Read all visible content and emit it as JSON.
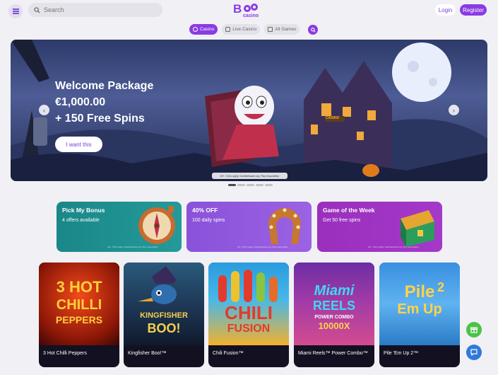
{
  "header": {
    "search_placeholder": "Search",
    "logo_text": "casino",
    "login_label": "Login",
    "register_label": "Register"
  },
  "tabs": [
    {
      "label": "Casino",
      "active": true
    },
    {
      "label": "Live Casino",
      "active": false
    },
    {
      "label": "All Games",
      "active": false
    }
  ],
  "hero": {
    "line1": "Welcome Package",
    "line2": "€1,000.00",
    "line3": "+ 150 Free Spins",
    "cta_label": "I want this",
    "tc": "18+. T&Cs apply. GambleAware.org. Play responsibly.",
    "sign_text": "CASINO",
    "slide_count": 5,
    "active_slide": 0
  },
  "promos": [
    {
      "title": "Pick My Bonus",
      "subtitle": "4 offers available",
      "tc": "18+. T&Cs apply. GambleAware.org. Play responsibly.",
      "color": "#1e8c8f"
    },
    {
      "title": "40% OFF",
      "subtitle": "100 daily spins",
      "tc": "18+. T&Cs apply. GambleAware.org. Play responsibly.",
      "color": "#8e56dd"
    },
    {
      "title": "Game of the Week",
      "subtitle": "Get 50 free spins",
      "tc": "18+. T&Cs apply. GambleAware.org. Play responsibly.",
      "color": "#9a2fbd"
    }
  ],
  "games": [
    {
      "name": "3 Hot Chilli Peppers",
      "art_l1": "3 HOT",
      "art_l2": "CHILLI",
      "art_l3": "PEPPERS"
    },
    {
      "name": "Kingfisher Boo!™",
      "art_l1": "KINGFISHER",
      "art_l2": "BOO!"
    },
    {
      "name": "Chili Fusion™",
      "art_l1": "CHILI",
      "art_l2": "FUSION"
    },
    {
      "name": "Miami Reels™ Power Combo™",
      "art_l1": "Miami",
      "art_l2": "REELS",
      "art_l3": "POWER COMBO",
      "art_l4": "10000X"
    },
    {
      "name": "Pile 'Em Up 2™",
      "art_l1": "Pile",
      "art_l2": "Em Up",
      "art_l3": "2"
    }
  ],
  "colors": {
    "accent": "#8a3be3",
    "background": "#f1f0f5",
    "gift_button": "#4cc24a",
    "chat_button": "#2f7ad8"
  },
  "icons": [
    "menu-icon",
    "search-icon",
    "boo-logo",
    "casino-chip-icon",
    "live-casino-icon",
    "all-games-icon",
    "chevron-left-icon",
    "chevron-right-icon",
    "gift-icon",
    "chat-icon"
  ]
}
